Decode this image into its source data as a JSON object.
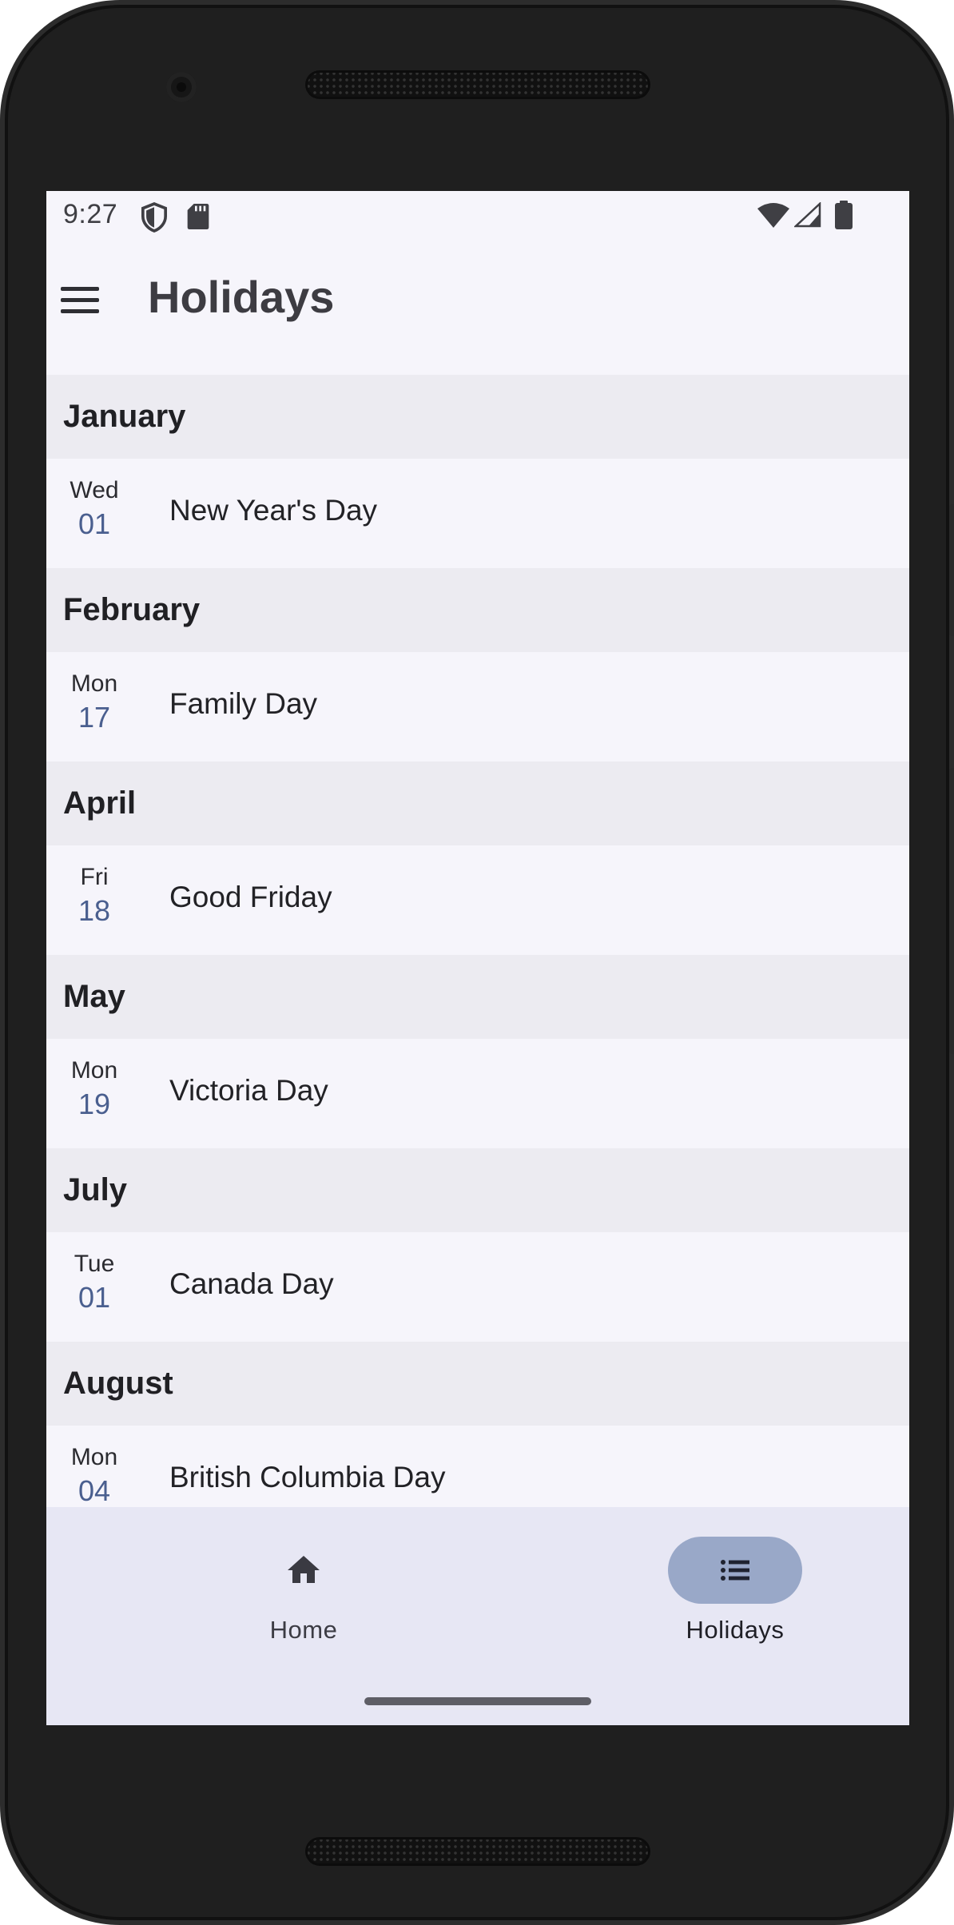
{
  "status_bar": {
    "time": "9:27",
    "left_icons": [
      "shield-icon",
      "sd-card-icon"
    ],
    "right_icons": [
      "wifi-icon",
      "signal-icon",
      "battery-icon"
    ]
  },
  "app_bar": {
    "menu_icon": "menu-icon",
    "title": "Holidays"
  },
  "holidays": [
    {
      "month": "January",
      "weekday": "Wed",
      "day": "01",
      "name": "New Year's Day"
    },
    {
      "month": "February",
      "weekday": "Mon",
      "day": "17",
      "name": "Family Day"
    },
    {
      "month": "April",
      "weekday": "Fri",
      "day": "18",
      "name": "Good Friday"
    },
    {
      "month": "May",
      "weekday": "Mon",
      "day": "19",
      "name": "Victoria Day"
    },
    {
      "month": "July",
      "weekday": "Tue",
      "day": "01",
      "name": "Canada Day"
    },
    {
      "month": "August",
      "weekday": "Mon",
      "day": "04",
      "name": "British Columbia Day"
    }
  ],
  "bottom_nav": {
    "items": [
      {
        "label": "Home",
        "icon": "home-icon",
        "active": false
      },
      {
        "label": "Holidays",
        "icon": "list-icon",
        "active": true
      }
    ]
  },
  "colors": {
    "accent_pill": "#99a8c8",
    "day_number": "#4a5f8f",
    "month_header_bg": "#ecebf1",
    "screen_bg": "#f6f5fb",
    "nav_bg": "#e7e7f4"
  }
}
